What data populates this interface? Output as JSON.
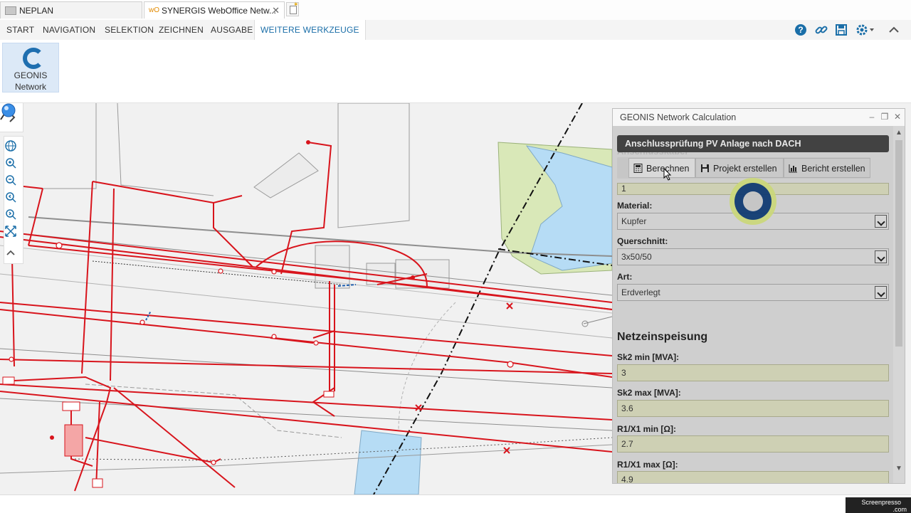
{
  "browser": {
    "tabs": [
      {
        "label": "NEPLAN",
        "active": false
      },
      {
        "label": "SYNERGIS WebOffice Netw...",
        "active": true
      }
    ]
  },
  "menu": {
    "items": [
      "START",
      "NAVIGATION",
      "SELEKTION",
      "ZEICHNEN",
      "AUSGABE",
      "WEITERE WERKZEUGE"
    ],
    "active": "WEITERE WERKZEUGE",
    "right_icons": [
      "help-icon",
      "link-icon",
      "save-icon",
      "settings-icon",
      "collapse-icon"
    ]
  },
  "ribbon": {
    "geonis_button": {
      "line1": "GEONIS",
      "line2": "Network"
    }
  },
  "map": {
    "tools": [
      "globe-icon",
      "zoom-in-icon",
      "zoom-out-icon",
      "zoom-previous-icon",
      "zoom-next-icon",
      "full-extent-icon",
      "collapse-up-icon"
    ]
  },
  "panel": {
    "title": "GEONIS Network Calculation",
    "ghost": "Anschlusskabel",
    "context_title": "Anschlussprüfung PV Anlage nach DACH",
    "toolbar": {
      "calculate": "Berechnen",
      "create_project": "Projekt erstellen",
      "create_report": "Bericht erstellen"
    },
    "fields": {
      "length_value": "1",
      "material_label": "Material:",
      "material_value": "Kupfer",
      "cross_section_label": "Querschnitt:",
      "cross_section_value": "3x50/50",
      "type_label": "Art:",
      "type_value": "Erdverlegt"
    },
    "section_title": "Netzeinspeisung",
    "feed": {
      "sk2_min_label": "Sk2 min [MVA]:",
      "sk2_min_value": "3",
      "sk2_max_label": "Sk2 max [MVA]:",
      "sk2_max_value": "3.6",
      "r1x1_min_label": "R1/X1 min [Ω]:",
      "r1x1_min_value": "2.7",
      "r1x1_max_label": "R1/X1 max [Ω]:",
      "r1x1_max_value": "4.9"
    }
  },
  "watermark": {
    "line1": "Screenpresso",
    "line2": ".com"
  },
  "colors": {
    "accent": "#1a6ea8",
    "network_line": "#d8141c",
    "water": "#b6dcf5",
    "green_area": "#d9e8b8"
  }
}
